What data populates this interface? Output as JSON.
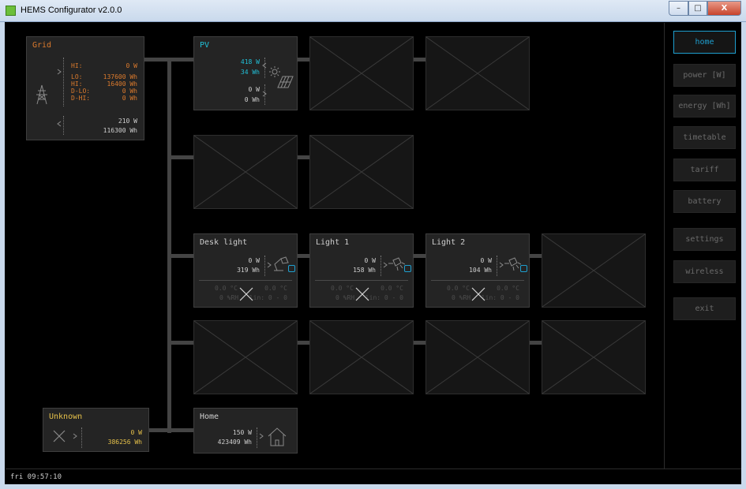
{
  "window": {
    "title": "HEMS Configurator v2.0.0",
    "min": "–",
    "max": "□",
    "close": "X"
  },
  "status": {
    "clock": "fri 09:57:10"
  },
  "nav": {
    "home": "home",
    "power": "power [W]",
    "energy": "energy [Wh]",
    "timetable": "timetable",
    "tariff": "tariff",
    "battery": "battery",
    "settings": "settings",
    "wireless": "wireless",
    "exit": "exit"
  },
  "grid": {
    "title": "Grid",
    "hi_label": "HI:",
    "hi_value": "0 W",
    "lo_label": "LO:",
    "lo_value": "137600 Wh",
    "hi2_label": "HI:",
    "hi2_value": "16400 Wh",
    "dlo_label": "D-LO:",
    "dlo_value": "0 Wh",
    "dhi_label": "D-HI:",
    "dhi_value": "0 Wh",
    "out_power": "210 W",
    "out_energy": "116300 Wh"
  },
  "pv": {
    "title": "PV",
    "prod_power": "418 W",
    "prod_energy": "34 Wh",
    "cons_power": "0 W",
    "cons_energy": "0 Wh"
  },
  "desk_light": {
    "title": "Desk light",
    "power": "0 W",
    "energy": "319 Wh",
    "temp1": "0.0 °C",
    "temp2": "0.0 °C",
    "hum": "0 %RH",
    "lin": "lin: 0 - 0"
  },
  "light1": {
    "title": "Light 1",
    "power": "0 W",
    "energy": "158 Wh",
    "temp1": "0.0 °C",
    "temp2": "0.0 °C",
    "hum": "0 %RH",
    "lin": "lin: 0 - 0"
  },
  "light2": {
    "title": "Light 2",
    "power": "0 W",
    "energy": "104 Wh",
    "temp1": "0.0 °C",
    "temp2": "0.0 °C",
    "hum": "0 %RH",
    "lin": "lin: 0 - 0"
  },
  "unknown": {
    "title": "Unknown",
    "power": "0 W",
    "energy": "386256 Wh"
  },
  "home": {
    "title": "Home",
    "power": "150 W",
    "energy": "423409 Wh"
  },
  "colors": {
    "accent": "#1e9fcf",
    "grid": "#dd7b2d",
    "pv": "#21c0d8",
    "unknown": "#e6c14a"
  }
}
